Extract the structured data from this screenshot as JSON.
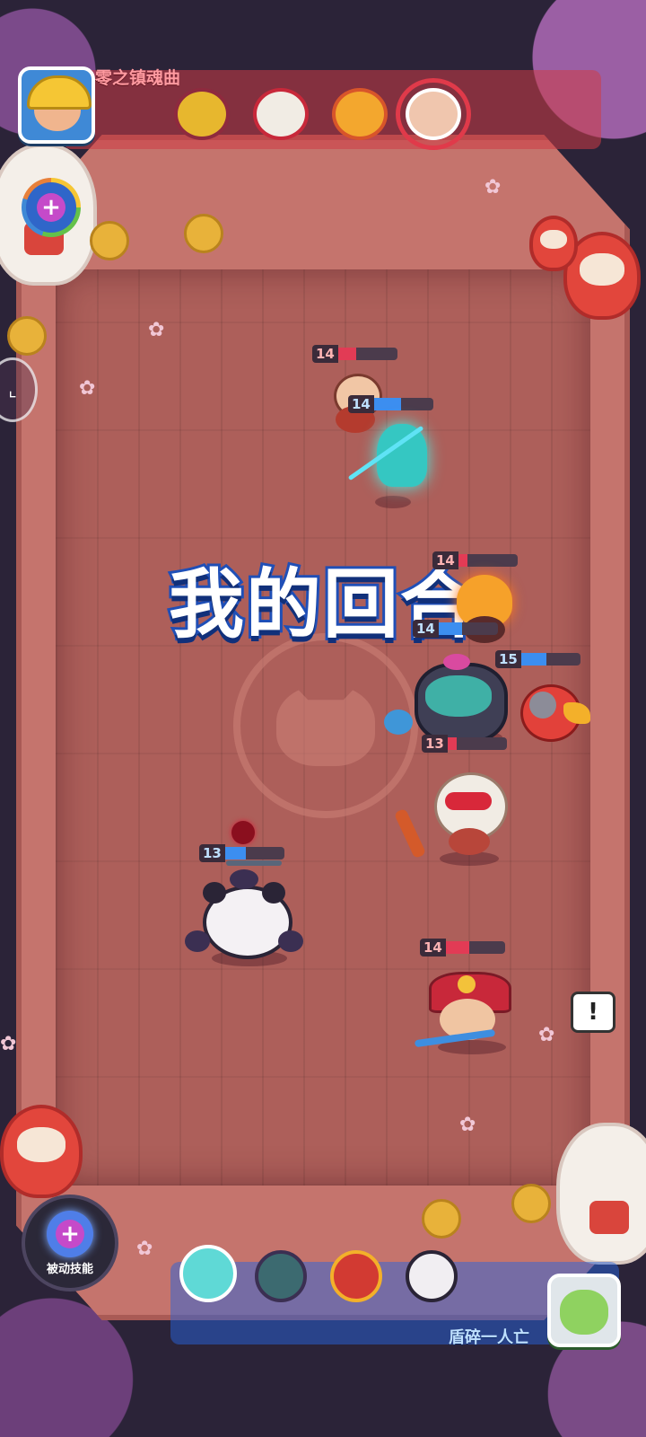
{
  "header": {
    "player_name": "零之镇魂曲",
    "turn_order_icons": [
      "samurai-portrait-icon",
      "monkey-king-portrait-icon",
      "fire-spirit-portrait-icon",
      "monk-portrait-icon"
    ]
  },
  "banner": {
    "text": "我的回合"
  },
  "units": {
    "monk": {
      "hp": "14",
      "hp_fraction": 0.3
    },
    "ghost_spearman": {
      "hp": "14",
      "hp_fraction": 0.45
    },
    "fire_spirit": {
      "hp": "14",
      "hp_fraction": 0.15
    },
    "ogre": {
      "hp": "14",
      "hp_fraction": 0.4
    },
    "flame_bird": {
      "hp": "15",
      "hp_fraction": 0.42
    },
    "monkey_king": {
      "hp": "13",
      "hp_fraction": 0.15
    },
    "panda": {
      "hp": "13",
      "hp_fraction": 0.35
    },
    "samurai": {
      "hp": "14",
      "hp_fraction": 0.4
    }
  },
  "bottom": {
    "passive_skill_label": "被动技能",
    "status_text": "盾碎一人亡",
    "queue_icons": [
      "ghost-portrait-icon",
      "ogre-portrait-icon",
      "flame-bird-portrait-icon",
      "panda-portrait-icon"
    ]
  },
  "colors": {
    "enemy_hp": "#e23b55",
    "ally_hp": "#3c8ef0",
    "banner_stroke": "#1f4fb7",
    "floor": "#ad5f5a"
  }
}
